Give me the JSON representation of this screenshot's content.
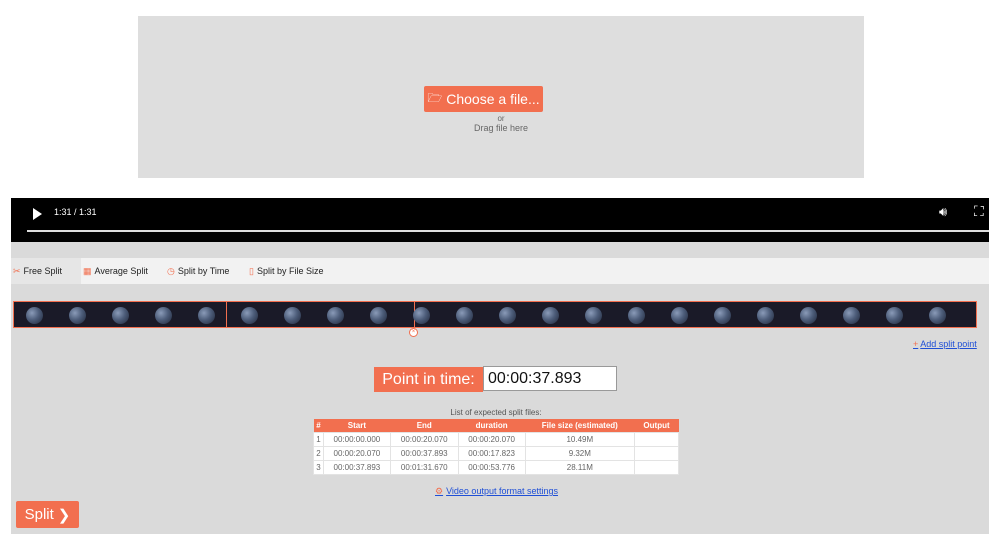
{
  "upload": {
    "button_label": "Choose a file...",
    "or_text": "or",
    "drag_text": "Drag file here"
  },
  "player": {
    "time_display": "1:31 / 1:31"
  },
  "tabs": [
    {
      "label": "Free Split",
      "icon": "scissors-icon",
      "active": true
    },
    {
      "label": "Average Split",
      "icon": "calendar-icon",
      "active": false
    },
    {
      "label": "Split by Time",
      "icon": "clock-icon",
      "active": false
    },
    {
      "label": "Split by File Size",
      "icon": "file-icon",
      "active": false
    }
  ],
  "add_split_point": "Add split point",
  "point_in_time": {
    "label": "Point in time:",
    "value": "00:00:37.893"
  },
  "split_table": {
    "caption": "List of expected split files:",
    "headers": [
      "#",
      "Start",
      "End",
      "duration",
      "File size (estimated)",
      "Output"
    ],
    "rows": [
      [
        "1",
        "00:00:00.000",
        "00:00:20.070",
        "00:00:20.070",
        "10.49M",
        ""
      ],
      [
        "2",
        "00:00:20.070",
        "00:00:37.893",
        "00:00:17.823",
        "9.32M",
        ""
      ],
      [
        "3",
        "00:00:37.893",
        "00:01:31.670",
        "00:00:53.776",
        "28.11M",
        ""
      ]
    ]
  },
  "video_output_settings": "Video output format settings",
  "split_button": "Split",
  "colors": {
    "accent": "#f26f4f",
    "link": "#1f4fd6"
  }
}
